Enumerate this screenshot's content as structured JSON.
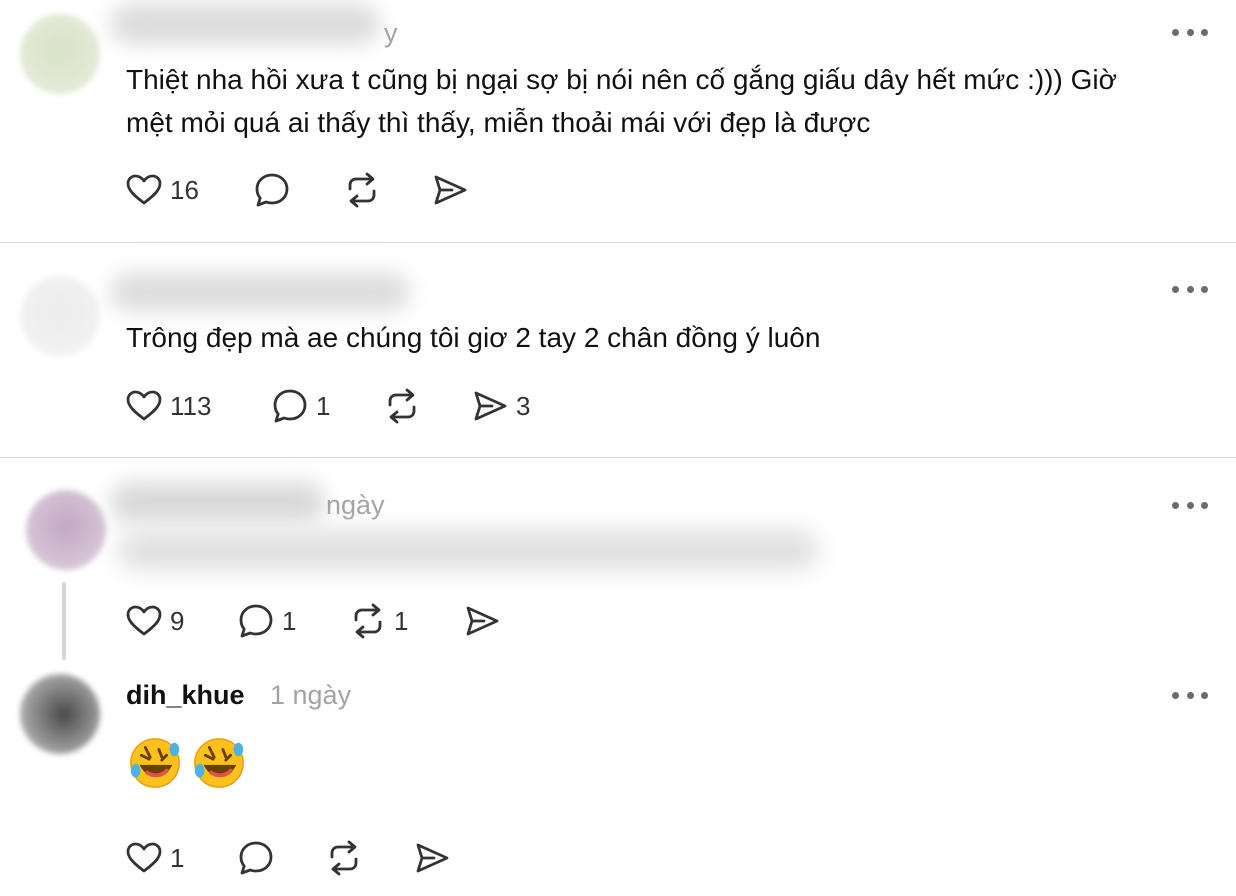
{
  "colors": {
    "text": "#111111",
    "muted": "#a3a3a3",
    "icon": "#333333",
    "divider": "#d7d7d7"
  },
  "posts": [
    {
      "timestamp_partial": "y",
      "text_line1": "Thiệt nha hồi xưa t cũng bị ngại sợ bị nói nên cố gắng giấu dây hết mức :))) Giờ",
      "text_line2": "mệt mỏi quá ai thấy thì thấy, miễn thoải mái với đẹp là được",
      "likes": "16",
      "replies": "",
      "reposts": "",
      "shares": ""
    },
    {
      "text_line1": "Trông đẹp mà ae chúng tôi giơ 2 tay 2 chân đồng ý luôn",
      "likes": "113",
      "replies": "1",
      "reposts": "",
      "shares": "3"
    },
    {
      "timestamp_partial": "ngày",
      "likes": "9",
      "replies": "1",
      "reposts": "1",
      "shares": ""
    },
    {
      "username": "dih_khue",
      "timestamp": "1 ngày",
      "emoji": "rolling-on-floor-laughing x2",
      "likes": "1",
      "replies": "",
      "reposts": "",
      "shares": ""
    }
  ],
  "icons": [
    "heart-icon",
    "comment-icon",
    "repost-icon",
    "share-icon",
    "more-icon"
  ]
}
